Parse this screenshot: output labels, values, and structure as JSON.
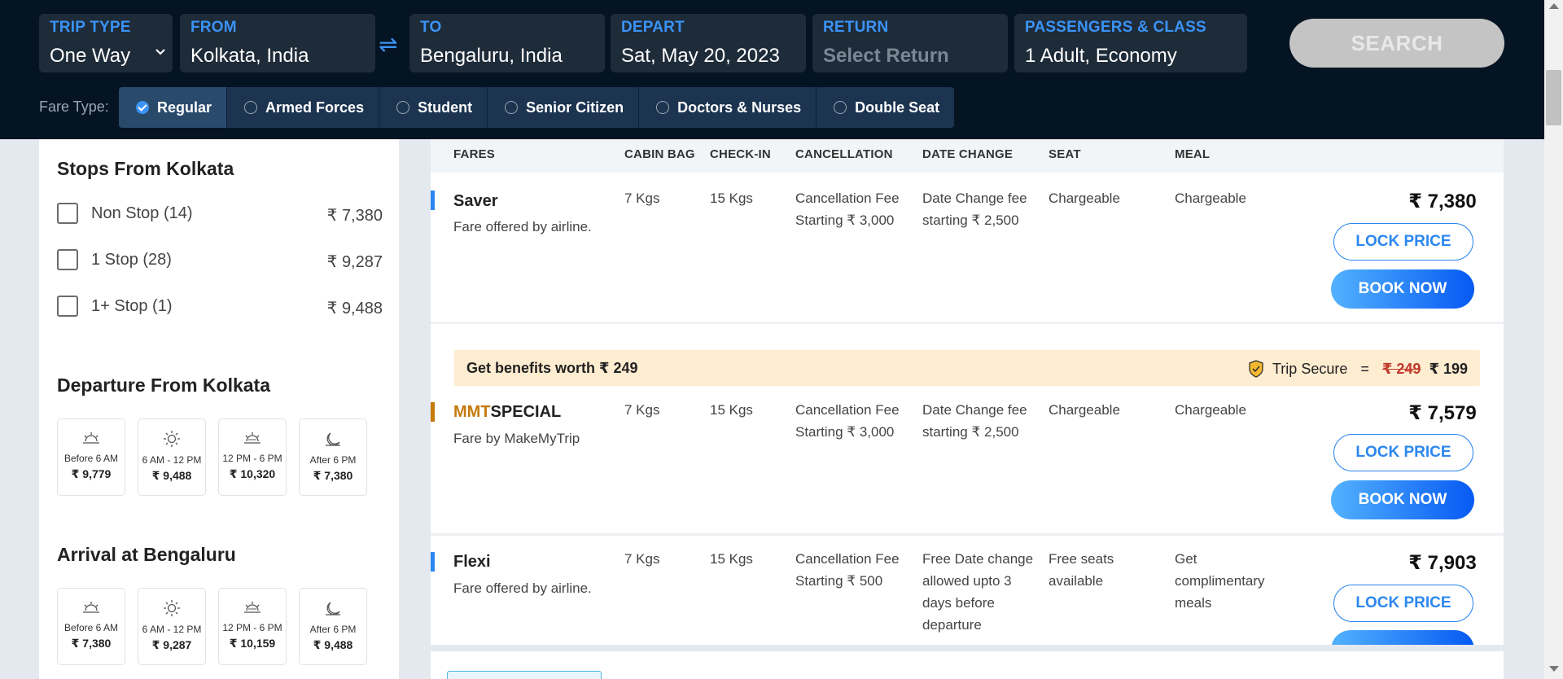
{
  "search": {
    "trip_type_label": "TRIP TYPE",
    "trip_type_value": "One Way",
    "from_label": "FROM",
    "from_value": "Kolkata, India",
    "to_label": "TO",
    "to_value": "Bengaluru, India",
    "depart_label": "DEPART",
    "depart_value": "Sat, May 20, 2023",
    "return_label": "RETURN",
    "return_placeholder": "Select Return",
    "pax_label": "PASSENGERS & CLASS",
    "pax_value": "1 Adult, Economy",
    "search_button": "SEARCH",
    "swap_icon": "⇌"
  },
  "fare_type": {
    "label": "Fare Type:",
    "options": [
      {
        "label": "Regular",
        "selected": true
      },
      {
        "label": "Armed Forces",
        "selected": false
      },
      {
        "label": "Student",
        "selected": false
      },
      {
        "label": "Senior Citizen",
        "selected": false
      },
      {
        "label": "Doctors & Nurses",
        "selected": false
      },
      {
        "label": "Double Seat",
        "selected": false
      }
    ]
  },
  "sidebar": {
    "stops_title": "Stops From Kolkata",
    "stops": [
      {
        "label": "Non Stop (14)",
        "price": "₹ 7,380"
      },
      {
        "label": "1 Stop (28)",
        "price": "₹ 9,287"
      },
      {
        "label": "1+ Stop (1)",
        "price": "₹ 9,488"
      }
    ],
    "departure_title": "Departure From Kolkata",
    "departure_slots": [
      {
        "label": "Before 6 AM",
        "price": "₹ 9,779",
        "icon": "sunrise-icon"
      },
      {
        "label": "6 AM - 12 PM",
        "price": "₹ 9,488",
        "icon": "sun-icon"
      },
      {
        "label": "12 PM - 6 PM",
        "price": "₹ 10,320",
        "icon": "sunset-icon"
      },
      {
        "label": "After 6 PM",
        "price": "₹ 7,380",
        "icon": "moon-icon"
      }
    ],
    "arrival_title": "Arrival at Bengaluru",
    "arrival_slots": [
      {
        "label": "Before 6 AM",
        "price": "₹ 7,380",
        "icon": "sunrise-icon"
      },
      {
        "label": "6 AM - 12 PM",
        "price": "₹ 9,287",
        "icon": "sun-icon"
      },
      {
        "label": "12 PM - 6 PM",
        "price": "₹ 10,159",
        "icon": "sunset-icon"
      },
      {
        "label": "After 6 PM",
        "price": "₹ 9,488",
        "icon": "moon-icon"
      }
    ]
  },
  "fares": {
    "columns": [
      "FARES",
      "CABIN BAG",
      "CHECK-IN",
      "CANCELLATION",
      "DATE CHANGE",
      "SEAT",
      "MEAL"
    ],
    "lock_label": "LOCK PRICE",
    "book_label": "BOOK NOW",
    "rows": [
      {
        "name": "Saver",
        "sub": "Fare offered by airline.",
        "cabin": "7 Kgs",
        "checkin": "15 Kgs",
        "cancel_1": "Cancellation Fee",
        "cancel_2": "Starting ₹ 3,000",
        "change_1": "Date Change fee",
        "change_2": "starting ₹ 2,500",
        "change_3": "",
        "change_4": "",
        "seat_1": "Chargeable",
        "seat_2": "",
        "meal_1": "Chargeable",
        "meal_2": "",
        "meal_3": "",
        "price": "₹ 7,380",
        "accent": "#2c87f0"
      },
      {
        "name_a": "MMT",
        "name_b": "SPECIAL",
        "sub": "Fare by MakeMyTrip",
        "cabin": "7 Kgs",
        "checkin": "15 Kgs",
        "cancel_1": "Cancellation Fee",
        "cancel_2": "Starting ₹ 3,000",
        "change_1": "Date Change fee",
        "change_2": "starting ₹ 2,500",
        "change_3": "",
        "change_4": "",
        "seat_1": "Chargeable",
        "seat_2": "",
        "meal_1": "Chargeable",
        "meal_2": "",
        "meal_3": "",
        "price": "₹ 7,579",
        "accent": "#c47a0a"
      },
      {
        "name": "Flexi",
        "sub": "Fare offered by airline.",
        "cabin": "7 Kgs",
        "checkin": "15 Kgs",
        "cancel_1": "Cancellation Fee",
        "cancel_2": "Starting ₹ 500",
        "change_1": "Free Date change",
        "change_2": "allowed upto 3",
        "change_3": "days before",
        "change_4": "departure",
        "seat_1": "Free seats",
        "seat_2": "available",
        "meal_1": "Get",
        "meal_2": "complimentary",
        "meal_3": "meals",
        "price": "₹ 7,903",
        "accent": "#2c87f0"
      }
    ],
    "benefits": {
      "text": "Get benefits worth ₹ 249",
      "product": "Trip Secure",
      "equals": "=",
      "old_price": "₹ 249",
      "new_price": "₹ 199",
      "icon": "shield-check-icon"
    }
  },
  "colors": {
    "header_bg": "#051423",
    "accent_blue": "#3b93f5",
    "mmt_gold": "#c47a0a",
    "benefit_bg": "#ffedd1"
  }
}
